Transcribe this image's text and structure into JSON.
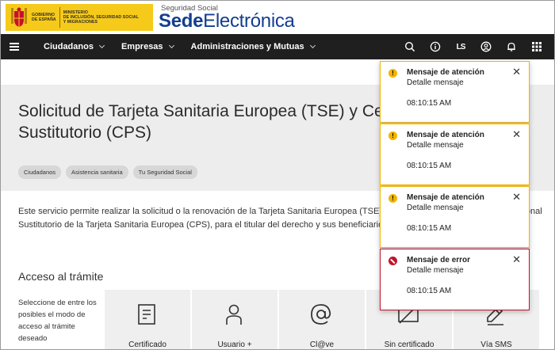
{
  "header": {
    "gov_text": [
      "GOBIERNO",
      "DE ESPAÑA"
    ],
    "ministry_text": [
      "MINISTERIO",
      "DE INCLUSIÓN, SEGURIDAD SOCIAL",
      "Y MIGRACIONES"
    ],
    "brand_small": "Seguridad Social",
    "brand_bold": "Sede",
    "brand_light": "Electrónica",
    "gov_color": "#f6ca1a",
    "brand_color": "#133e8f"
  },
  "nav": {
    "items": [
      {
        "label": "Ciudadanos"
      },
      {
        "label": "Empresas"
      },
      {
        "label": "Administraciones y Mutuas"
      }
    ],
    "icons": [
      "search-icon",
      "info-icon",
      "easy-read-icon",
      "user-icon",
      "notifications-icon",
      "apps-grid-icon"
    ],
    "easy_read_label": "LS",
    "background": "#1f1f1f"
  },
  "page": {
    "title": "Solicitud de Tarjeta Sanitaria Europea (TSE) y Certificado Provisional Sustitutorio (CPS)",
    "tags": [
      "Ciudadanos",
      "Asistencia sanitaria",
      "Tu Seguridad Social"
    ],
    "description": "Este servicio permite realizar la solicitud o la renovación de la Tarjeta Sanitaria Europea (TSE) o, en su caso, del Certificado Provisional Sustitutorio de la Tarjeta Sanitaria Europea (CPS), para el titular del derecho y sus beneficiarios.",
    "access_heading": "Acceso al trámite",
    "access_note": "Seleccione de entre los posibles el modo de acceso al trámite deseado",
    "methods": [
      {
        "label": "Certificado",
        "icon": "certificate-icon"
      },
      {
        "label": "Usuario +",
        "icon": "user-plus-icon"
      },
      {
        "label": "Cl@ve",
        "icon": "at-sign-icon"
      },
      {
        "label": "Sin certificado",
        "icon": "no-certificate-icon"
      },
      {
        "label": "Vía SMS",
        "icon": "sms-edit-icon"
      }
    ]
  },
  "notifications": [
    {
      "type": "warning",
      "title": "Mensaje de atención",
      "detail": "Detalle mensaje",
      "time": "08:10:15 AM"
    },
    {
      "type": "warning",
      "title": "Mensaje de atención",
      "detail": "Detalle mensaje",
      "time": "08:10:15 AM"
    },
    {
      "type": "warning",
      "title": "Mensaje de atención",
      "detail": "Detalle mensaje",
      "time": "08:10:15 AM"
    },
    {
      "type": "error",
      "title": "Mensaje de error",
      "detail": "Detalle mensaje",
      "time": "08:10:15 AM"
    }
  ],
  "colors": {
    "warning": "#f2b400",
    "error": "#c3122b"
  }
}
